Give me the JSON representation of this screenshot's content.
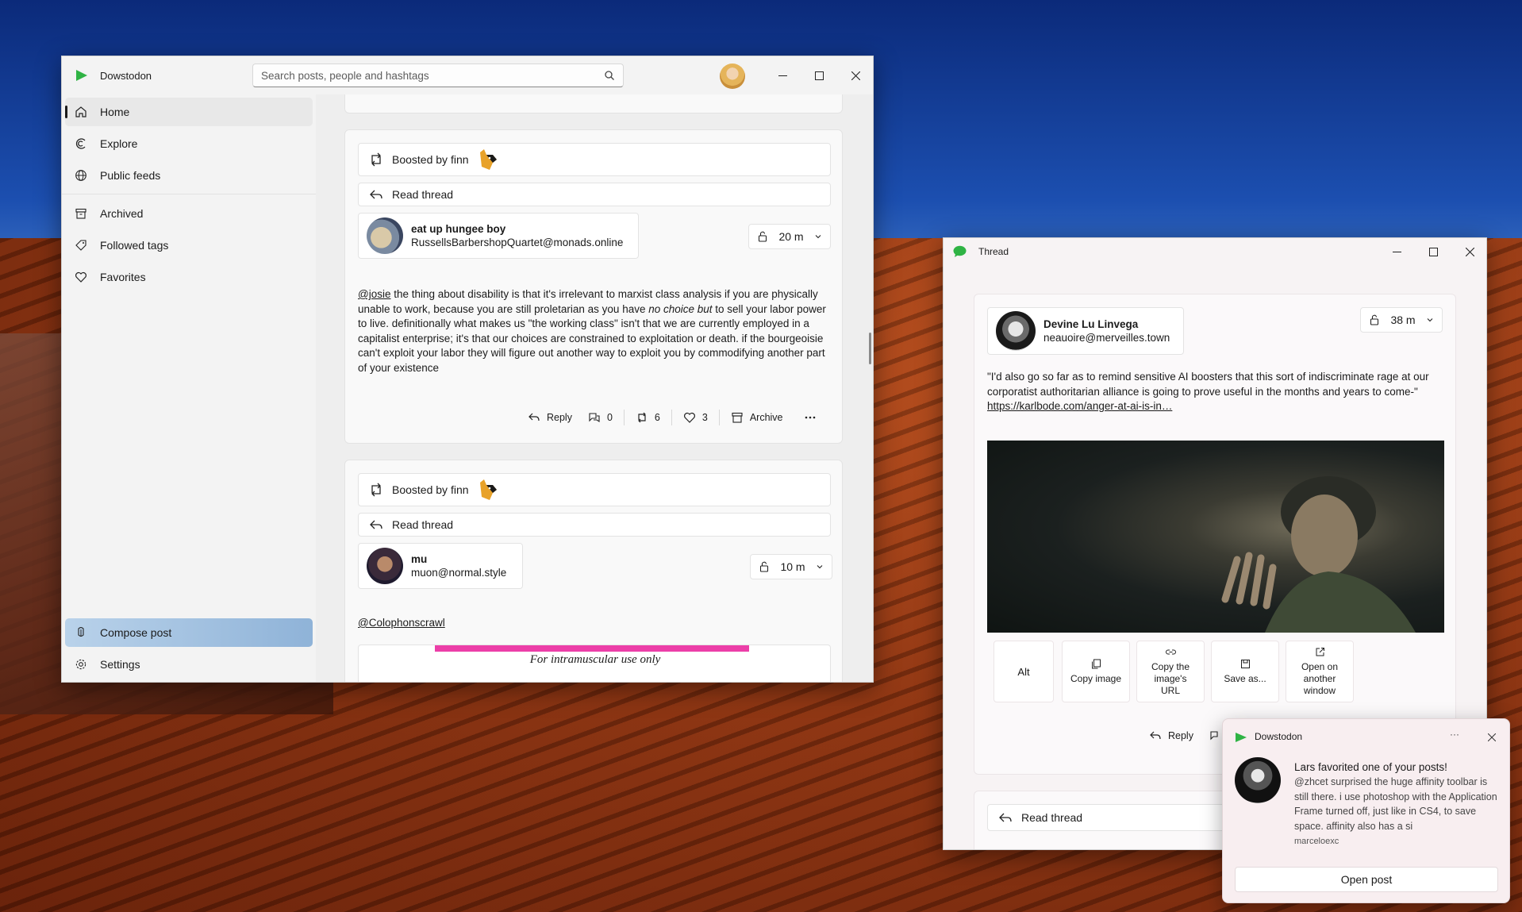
{
  "main_window": {
    "title": "Dowstodon",
    "search_placeholder": "Search posts, people and hashtags",
    "sidebar": {
      "items": [
        {
          "label": "Home",
          "icon": "home-icon"
        },
        {
          "label": "Explore",
          "icon": "explore-icon"
        },
        {
          "label": "Public feeds",
          "icon": "globe-icon"
        },
        {
          "label": "Archived",
          "icon": "archive-icon"
        },
        {
          "label": "Followed tags",
          "icon": "tag-icon"
        },
        {
          "label": "Favorites",
          "icon": "heart-icon"
        }
      ],
      "compose": "Compose post",
      "settings": "Settings"
    },
    "posts": [
      {
        "boosted_by": "Boosted by finn",
        "read_thread": "Read thread",
        "author_name": "eat up hungee boy",
        "author_handle": "RussellsBarbershopQuartet@monads.online",
        "time": "20 m",
        "text_mention": "@josie",
        "text_1": " the thing about disability is that it's irrelevant to marxist class analysis if you are physically unable to work, because you are still proletarian as you have ",
        "text_em": "no choice but",
        "text_2": " to sell your labor power to live. definitionally what makes us \"the working class\" isn't that we are currently employed in a capitalist enterprise; it's that our choices are constrained to exploitation or death. if the bourgeoisie can't exploit your labor they will figure out another way to exploit you by commodifying another part of your existence",
        "actions": {
          "reply": "Reply",
          "quotes": "0",
          "boosts": "6",
          "favorites": "3",
          "archive": "Archive"
        }
      },
      {
        "boosted_by": "Boosted by finn",
        "read_thread": "Read thread",
        "author_name": "mu",
        "author_handle": "muon@normal.style",
        "time": "10 m",
        "text_mention": "@Colophonscrawl",
        "image_caption": "For intramuscular use only"
      }
    ]
  },
  "thread_window": {
    "title": "Thread",
    "author_name": "Devine Lu Linvega",
    "author_handle": "neauoire@merveilles.town",
    "time": "38 m",
    "text": "\"I'd also go so far as to remind sensitive AI boosters that this sort of indiscriminate rage at our corporatist authoritarian alliance is going to prove useful in the months and years to come-\"",
    "link": "https://karlbode.com/anger-at-ai-is-in…",
    "media_buttons": {
      "alt": "Alt",
      "copy_image": "Copy image",
      "copy_url": "Copy the image's URL",
      "save_as": "Save as...",
      "open_window": "Open on another window"
    },
    "reply": "Reply",
    "read_thread": "Read thread"
  },
  "notification": {
    "app": "Dowstodon",
    "title": "Lars favorited one of your posts!",
    "body": "@zhcet surprised the huge affinity toolbar is still there. i use photoshop with the Application Frame turned off, just like in CS4, to save space. affinity also has a si",
    "user": "marceloexc",
    "button": "Open post",
    "more": "···"
  },
  "colors": {
    "accent_green": "#2fb344",
    "compose_blue": "#9fbfe0"
  }
}
